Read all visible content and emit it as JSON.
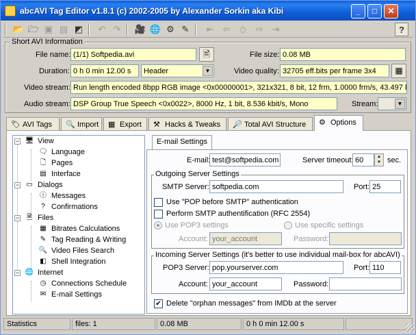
{
  "window": {
    "title": "abcAVI Tag Editor v1.8.1 (c) 2002-2005 by Alexander Sorkin aka Kibi"
  },
  "titlebar_buttons": [
    "minimize-icon",
    "maximize-icon",
    "close-icon"
  ],
  "toolbar": {
    "icons": [
      "open-folder-icon",
      "open-multiple-icon",
      "save-icon",
      "save-all-icon",
      "export-icon",
      "undo-icon",
      "redo-icon",
      "film-icon",
      "globe-icon",
      "settings-icon",
      "tools-icon",
      "first-icon",
      "prev-icon",
      "diamond-icon",
      "next-icon",
      "last-icon"
    ],
    "help": "?"
  },
  "short_info": {
    "title": "Short AVI Information",
    "file_name_label": "File name:",
    "file_name": "(1/1) Softpedia.avi",
    "file_size_label": "File size:",
    "file_size": "0.08 MB",
    "duration_label": "Duration:",
    "duration": "0 h 0 min 12.00 s",
    "header_option": "Header",
    "video_quality_label": "Video quality:",
    "video_quality": "32705 eff.bits per frame 3x4",
    "video_stream_label": "Video stream:",
    "video_stream": "Run length encoded 8bpp RGB image <0x00000001>, 321x321, 8 bit, 12 frm, 1.0000 frm/s, 43.497 kbit/s",
    "audio_stream_label": "Audio stream:",
    "audio_stream": "DSP Group True Speech <0x0022>, 8000 Hz, 1 bit, 8.536 kbit/s, Mono",
    "stream_label": "Stream:"
  },
  "tabs": [
    {
      "label": "AVI Tags",
      "icon": "tag-icon"
    },
    {
      "label": "Import",
      "icon": "magnifier-icon"
    },
    {
      "label": "Export",
      "icon": "table-icon"
    },
    {
      "label": "Hacks & Tweaks",
      "icon": "tools-icon"
    },
    {
      "label": "Total AVI Structure",
      "icon": "search-icon"
    },
    {
      "label": "Options",
      "icon": "options-icon"
    }
  ],
  "tree": {
    "view": "View",
    "language": "Language",
    "pages": "Pages",
    "interface": "Interface",
    "dialogs": "Dialogs",
    "messages": "Messages",
    "confirmations": "Confirmations",
    "files": "Files",
    "bitrates": "Bitrates Calculations",
    "tag_rw": "Tag Reading & Writing",
    "video_search": "Video Files Search",
    "shell": "Shell Integration",
    "internet": "Internet",
    "conn_schedule": "Connections Schedule",
    "email_settings": "E-mail Settings"
  },
  "email": {
    "tab": "E-mail Settings",
    "email_label": "E-mail:",
    "email_value": "test@softpedia.com",
    "timeout_label": "Server timeout:",
    "timeout_value": "60",
    "timeout_unit": "sec.",
    "outgoing_title": "Outgoing Server Settings",
    "smtp_label": "SMTP Server:",
    "smtp_value": "softpedia.com",
    "port_label": "Port:",
    "smtp_port": "25",
    "pop_before_smtp": "Use \"POP before SMTP\" authentication",
    "smtp_auth": "Perform SMTP authentification (RFC 2554)",
    "use_pop3": "Use POP3 settings",
    "use_specific": "Use specific settings",
    "account_label": "Account:",
    "account_out": "your_account",
    "password_label": "Password:",
    "incoming_title": "Incoming Server Settings (it's better to use individual mail-box for abcAVI)",
    "pop3_label": "POP3 Server:",
    "pop3_value": "pop.yourserver.com",
    "pop3_port": "110",
    "account_in": "your_account",
    "delete_orphan": "Delete \"orphan messages\" from IMDb at the server",
    "delete_orphan_checked": true
  },
  "status": {
    "label": "Statistics",
    "files": "files: 1",
    "size": "0.08 MB",
    "duration": "0 h 0 min 12.00 s"
  }
}
